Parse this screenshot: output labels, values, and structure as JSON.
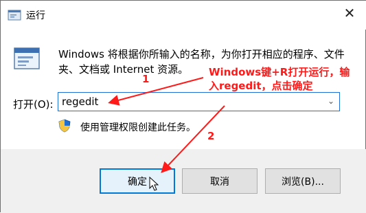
{
  "window": {
    "title": "运行",
    "close_glyph": "✕",
    "title_icon": "run-icon"
  },
  "main": {
    "description": "Windows 将根据你所输入的名称，为你打开相应的程序、文件夹、文档或 Internet 资源。",
    "open_label": "打开(O):",
    "open_value": "regedit",
    "admin_text": "使用管理权限创建此任务。"
  },
  "buttons": {
    "ok": "确定",
    "cancel": "取消",
    "browse": "浏览(B)..."
  },
  "annotation": {
    "instruction": "Windows键+R打开运行，输入regedit，点击确定",
    "step1": "1",
    "step2": "2",
    "color": "#ff1a1a"
  }
}
